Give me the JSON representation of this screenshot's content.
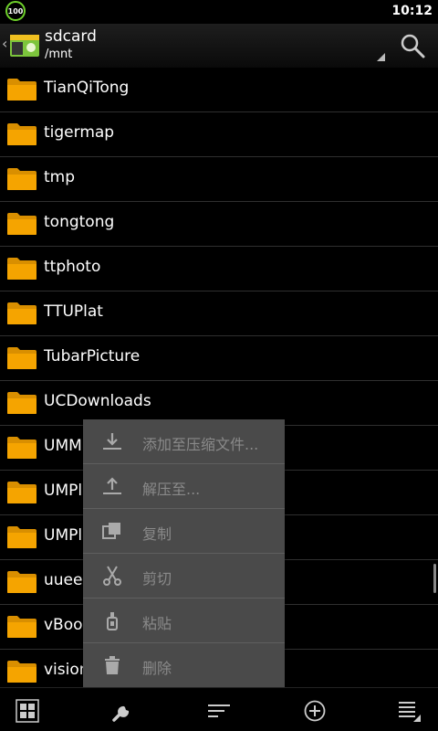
{
  "status": {
    "battery": "100",
    "time": "10:12"
  },
  "header": {
    "title": "sdcard",
    "path": "/mnt"
  },
  "files": [
    "TianQiTong",
    "tigermap",
    "tmp",
    "tongtong",
    "ttphoto",
    "TTUPlat",
    "TubarPicture",
    "UCDownloads",
    "UMM",
    "UMPl",
    "UMPl",
    "uuee",
    "vBool",
    "vision"
  ],
  "context_menu": [
    {
      "label": "添加至压缩文件...",
      "icon": "download-icon"
    },
    {
      "label": "解压至...",
      "icon": "upload-icon"
    },
    {
      "label": "复制",
      "icon": "copy-icon"
    },
    {
      "label": "剪切",
      "icon": "scissors-icon"
    },
    {
      "label": "粘贴",
      "icon": "glue-bottle-icon"
    },
    {
      "label": "删除",
      "icon": "trash-icon"
    }
  ],
  "colors": {
    "folder": "#f5a400",
    "menu_bg": "#4a4a4a",
    "battery": "#6fd12b"
  }
}
